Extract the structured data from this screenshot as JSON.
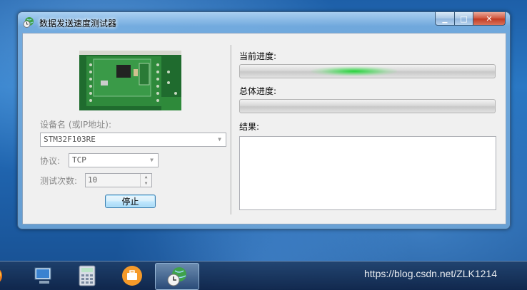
{
  "window": {
    "title": "数据发送速度测试器",
    "minimize_glyph": "▁",
    "maximize_glyph": "□",
    "close_glyph": "✕"
  },
  "left": {
    "device_label": "设备名 (或IP地址):",
    "device_value": "STM32F103RE",
    "protocol_label": "协议:",
    "protocol_value": "TCP",
    "count_label": "测试次数:",
    "count_value": "10",
    "stop_label": "停止"
  },
  "right": {
    "current_progress_label": "当前进度:",
    "total_progress_label": "总体进度:",
    "result_label": "结果:",
    "result_text": ""
  },
  "watermark": "https://blog.csdn.net/ZLK1214",
  "icons": {
    "app": "stopwatch-globe-icon",
    "dropdown": "chevron-down-icon"
  },
  "colors": {
    "progress_glow": "#22d23c",
    "button_border": "#3c7fb1",
    "disabled_text": "#8a8a8a"
  }
}
